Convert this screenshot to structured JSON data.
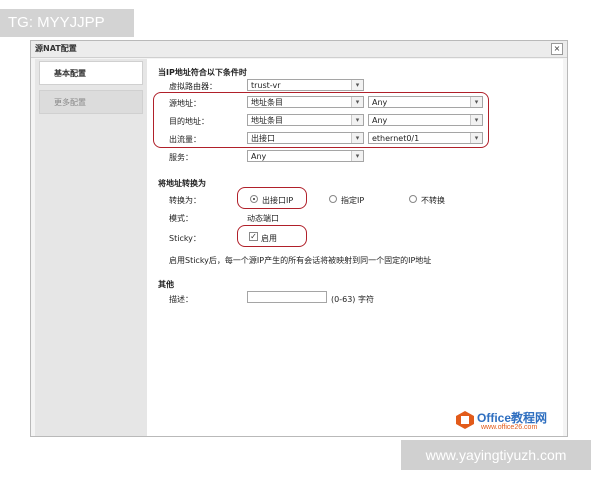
{
  "watermark_top": "TG: MYYJJPP",
  "watermark_bottom": "www.yayingtiyuzh.com",
  "dialog": {
    "title": "源NAT配置",
    "close_glyph": "×"
  },
  "sidebar": {
    "tabs": [
      {
        "label": "基本配置"
      },
      {
        "label": "更多配置"
      }
    ]
  },
  "conditions": {
    "heading": "当IP地址符合以下条件时",
    "virtual_router": {
      "label": "虚拟路由器：",
      "value": "trust-vr"
    },
    "source": {
      "label": "源地址：",
      "type": "地址条目",
      "value": "Any"
    },
    "destination": {
      "label": "目的地址：",
      "type": "地址条目",
      "value": "Any"
    },
    "egress": {
      "label": "出流量：",
      "type": "出接口",
      "value": "ethernet0/1"
    },
    "service": {
      "label": "服务：",
      "value": "Any"
    }
  },
  "translation": {
    "heading": "将地址转换为",
    "translate_label": "转换为：",
    "options": [
      {
        "label": "出接口IP",
        "selected": true
      },
      {
        "label": "指定IP",
        "selected": false
      },
      {
        "label": "不转换",
        "selected": false
      }
    ],
    "mode_label": "模式：",
    "mode_value": "动态端口",
    "sticky_label": "Sticky：",
    "sticky_check_label": "启用",
    "sticky_checked": true,
    "sticky_check_glyph": "✓",
    "note": "启用Sticky后，每一个源IP产生的所有会话将被映射到同一个固定的IP地址"
  },
  "other": {
    "heading": "其他",
    "desc_label": "描述：",
    "desc_value": "",
    "desc_hint": "(0-63) 字符"
  },
  "dropdown_glyph": "▾",
  "logo": {
    "text": "Office教程网",
    "url": "www.office26.com"
  },
  "colors": {
    "highlight": "#b0202a",
    "logo_blue": "#2f6fc0",
    "logo_orange": "#e25b1a"
  }
}
